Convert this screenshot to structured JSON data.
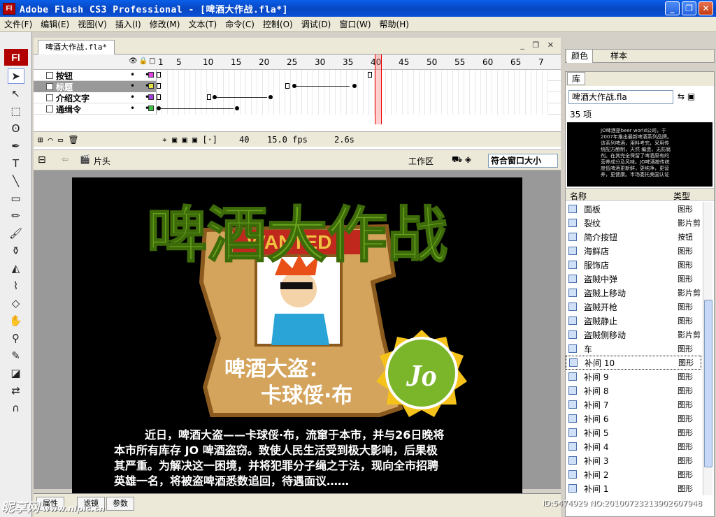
{
  "window": {
    "title": "Adobe Flash CS3 Professional - [啤酒大作战.fla*]",
    "app_icon": "Fl",
    "buttons": [
      "minimize",
      "restore",
      "close"
    ]
  },
  "menubar": [
    "文件(F)",
    "编辑(E)",
    "视图(V)",
    "插入(I)",
    "修改(M)",
    "文本(T)",
    "命令(C)",
    "控制(O)",
    "调试(D)",
    "窗口(W)",
    "帮助(H)"
  ],
  "toolbox": {
    "logo": "Fl"
  },
  "document": {
    "tab": "啤酒大作战.fla*",
    "frame_numbers": [
      "1",
      "5",
      "10",
      "15",
      "20",
      "25",
      "30",
      "35",
      "40",
      "45",
      "50",
      "55",
      "60",
      "65",
      "7"
    ],
    "layers": [
      {
        "name": "按钮",
        "color": "#e040e0",
        "selected": false
      },
      {
        "name": "标题",
        "color": "#e0e040",
        "selected": true
      },
      {
        "name": "介绍文字",
        "color": "#a040e0",
        "selected": false
      },
      {
        "name": "通缉令",
        "color": "#40c040",
        "selected": false
      }
    ],
    "current_frame": "40",
    "fps": "15.0 fps",
    "time": "2.6s",
    "scene": "片头",
    "workspace": "工作区",
    "zoom": "符合窗口大小"
  },
  "stage": {
    "headline": "啤酒大作战",
    "wanted": "WANTED",
    "char_name_1": "啤酒大盗：",
    "char_name_2": "卡球俀·布",
    "badge_letter": "Jo",
    "body_text": [
      "近日，啤酒大盗——卡球俀·布，流窜于本市，并与26日晚将",
      "本市所有库存 JO 啤酒盗窃。致使人民生活受到极大影响，后果极",
      "其严重。为解决这一困境，并将犯罪分子绳之于法，现向全市招聘",
      "英雄一名，将被盗啤酒悉数追回，待遇面议……"
    ]
  },
  "bottom_tabs": [
    "属性",
    "滤镜",
    "参数"
  ],
  "color_panel": {
    "tabs": [
      "颜色",
      "样本"
    ]
  },
  "library": {
    "tab": "库",
    "file": "啤酒大作战.fla",
    "count": "35 项",
    "preview_lines": [
      "JO啤酒是beer world公司，于",
      "2007年推出最新啤酒系列品牌。",
      "",
      "该系列啤酒，用料考究，采用传",
      "统配方酿制，天然 编造，无防腐",
      "剂。在其完全保留了啤酒原有的",
      "营养成分及风味。JO啤酒按传统",
      "度低啤酒更新鲜，更纯净，更营",
      "养，更健康。市场委托美国认证",
      "体验！"
    ],
    "col_name": "名称",
    "col_type": "类型",
    "items": [
      {
        "name": "面板",
        "type": "图形"
      },
      {
        "name": "裂纹",
        "type": "影片剪"
      },
      {
        "name": "简介按钮",
        "type": "按钮"
      },
      {
        "name": "海鲜店",
        "type": "图形"
      },
      {
        "name": "服饰店",
        "type": "图形"
      },
      {
        "name": "盗贼中弹",
        "type": "图形"
      },
      {
        "name": "盗贼上移动",
        "type": "影片剪"
      },
      {
        "name": "盗贼开枪",
        "type": "图形"
      },
      {
        "name": "盗贼静止",
        "type": "图形"
      },
      {
        "name": "盗贼侧移动",
        "type": "影片剪"
      },
      {
        "name": "车",
        "type": "图形"
      },
      {
        "name": "补间 10",
        "type": "图形"
      },
      {
        "name": "补间 9",
        "type": "图形"
      },
      {
        "name": "补间 8",
        "type": "图形"
      },
      {
        "name": "补间 7",
        "type": "图形"
      },
      {
        "name": "补间 6",
        "type": "图形"
      },
      {
        "name": "补间 5",
        "type": "图形"
      },
      {
        "name": "补间 4",
        "type": "图形"
      },
      {
        "name": "补间 3",
        "type": "图形"
      },
      {
        "name": "补间 2",
        "type": "图形"
      },
      {
        "name": "补间 1",
        "type": "图形"
      }
    ]
  },
  "watermark": {
    "text": "昵享网",
    "url": "www.nipic.cn",
    "id": "ID:5474929 NO:20100723213902607948"
  }
}
